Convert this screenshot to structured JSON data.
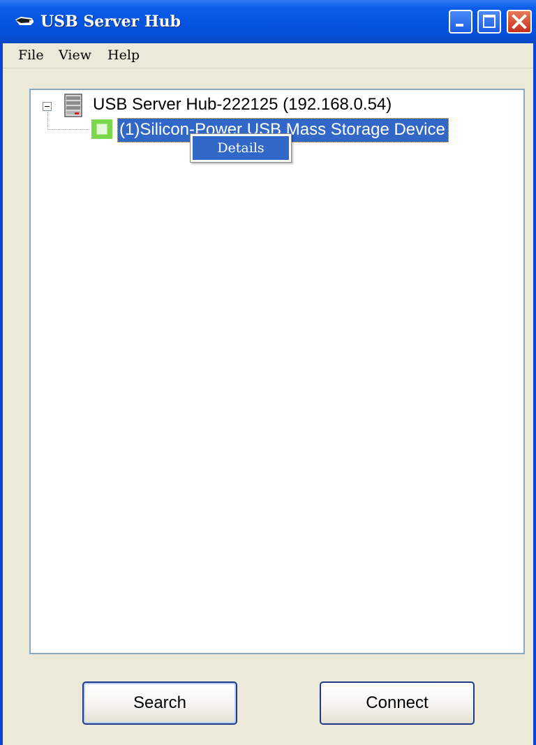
{
  "window": {
    "title": "USB Server Hub",
    "title_icon": "usb-plug-icon",
    "controls": {
      "minimize_icon": "minimize-icon",
      "maximize_icon": "maximize-icon",
      "close_icon": "close-icon"
    }
  },
  "menubar": {
    "items": [
      {
        "label": "File"
      },
      {
        "label": "View"
      },
      {
        "label": "Help"
      }
    ]
  },
  "tree": {
    "root": {
      "label": "USB Server Hub-222125 (192.168.0.54)",
      "icon": "server-icon",
      "expanded": true
    },
    "children": [
      {
        "label": "(1)Silicon-Power USB Mass Storage Device",
        "icon": "usb-device-icon",
        "selected": true
      }
    ]
  },
  "context_menu": {
    "items": [
      {
        "label": "Details"
      }
    ]
  },
  "buttons": {
    "search_label": "Search",
    "connect_label": "Connect"
  },
  "colors": {
    "titlebar": "#0554e0",
    "selection": "#3168c8",
    "window_bg": "#ece9d8",
    "device_icon": "#7ad84a",
    "close_button": "#c4301a"
  }
}
